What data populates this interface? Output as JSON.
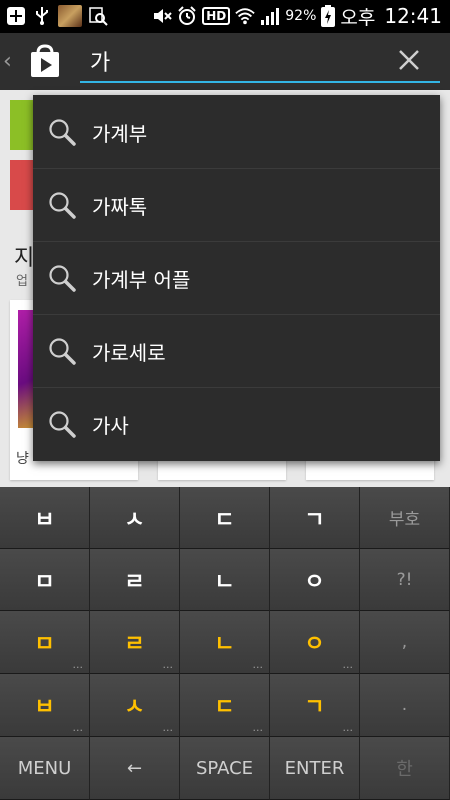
{
  "status_bar": {
    "battery_percent": "92%",
    "ampm": "오후",
    "time": "12:41",
    "left_icons": [
      "plus-icon",
      "usb-icon",
      "game-thumbnail-icon",
      "search-image-icon"
    ],
    "right_icons": [
      "mute-icon",
      "alarm-icon",
      "hd-icon",
      "wifi-icon",
      "signal-icon",
      "battery-icon"
    ],
    "hd_label": "HD"
  },
  "action_bar": {
    "back_glyph": "‹",
    "search_value": "가",
    "accent_color": "#33b5e5"
  },
  "background": {
    "heading_partial": "지",
    "sub_partial": "업",
    "cards": [
      {
        "caption": "냥"
      },
      {
        "caption": ""
      },
      {
        "caption": ""
      }
    ]
  },
  "suggestions": [
    {
      "text": "가계부"
    },
    {
      "text": "가짜톡"
    },
    {
      "text": "가계부 어플"
    },
    {
      "text": "가로세로"
    },
    {
      "text": "가사"
    }
  ],
  "keyboard": {
    "rows": [
      [
        {
          "label": "ㅂ"
        },
        {
          "label": "ㅅ"
        },
        {
          "label": "ㄷ"
        },
        {
          "label": "ㄱ"
        },
        {
          "label": "부호",
          "side": true
        }
      ],
      [
        {
          "label": "ㅁ"
        },
        {
          "label": "ㄹ"
        },
        {
          "label": "ㄴ"
        },
        {
          "label": "ㅇ"
        },
        {
          "label": "?!",
          "side": true
        }
      ],
      [
        {
          "label": "ㅁ",
          "yellow": true,
          "dots": "..."
        },
        {
          "label": "ㄹ",
          "yellow": true,
          "dots": "..."
        },
        {
          "label": "ㄴ",
          "yellow": true,
          "dots": "..."
        },
        {
          "label": "ㅇ",
          "yellow": true,
          "dots": "..."
        },
        {
          "label": ",",
          "side": true
        }
      ],
      [
        {
          "label": "ㅂ",
          "yellow": true,
          "dots": "..."
        },
        {
          "label": "ㅅ",
          "yellow": true,
          "dots": "..."
        },
        {
          "label": "ㄷ",
          "yellow": true,
          "dots": "..."
        },
        {
          "label": "ㄱ",
          "yellow": true,
          "dots": "..."
        },
        {
          "label": ".",
          "side": true
        }
      ]
    ],
    "bottom_row": [
      {
        "label": "MENU",
        "name": "menu-key"
      },
      {
        "label": "←",
        "name": "backspace-key"
      },
      {
        "label": "SPACE",
        "name": "space-key"
      },
      {
        "label": "ENTER",
        "name": "enter-key"
      },
      {
        "label": "한",
        "name": "language-key"
      }
    ],
    "highlight_color": "#ffc000"
  }
}
